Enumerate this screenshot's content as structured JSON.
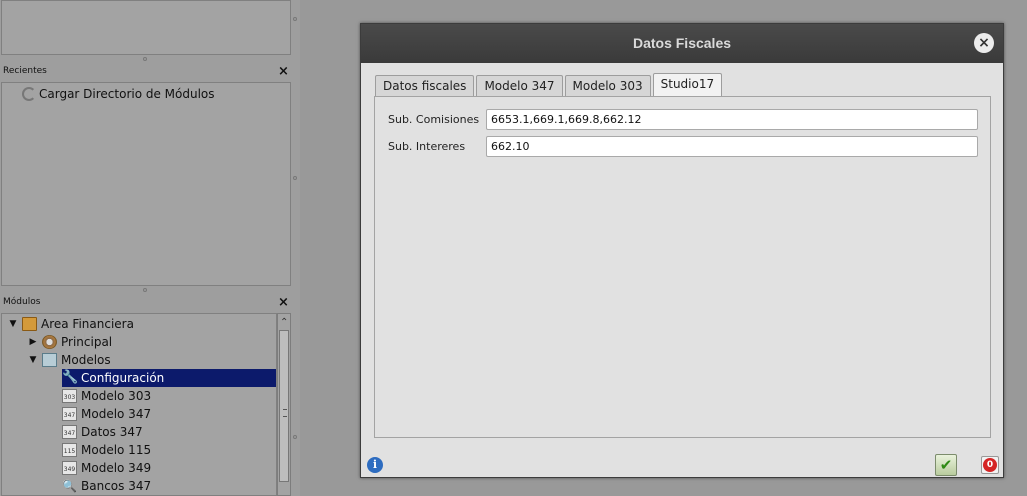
{
  "left_panel": {
    "recientes": {
      "title": "Recientes",
      "close_label": "×",
      "items": [
        {
          "label": "Cargar Directorio de Módulos"
        }
      ]
    },
    "modulos": {
      "title": "Módulos",
      "close_label": "×",
      "tree": [
        {
          "label": "Area Financiera",
          "arrow": "v",
          "icon": "folder-icon"
        },
        {
          "label": "Principal",
          "arrow": ">",
          "icon": "gear-icon"
        },
        {
          "label": "Modelos",
          "arrow": "v",
          "icon": "models-icon"
        },
        {
          "label": "Configuración",
          "icon": "wrench-icon",
          "selected": true
        },
        {
          "label": "Modelo 303",
          "icon": "document-icon",
          "icon_text": "303"
        },
        {
          "label": "Modelo 347",
          "icon": "document-icon",
          "icon_text": "347"
        },
        {
          "label": "Datos 347",
          "icon": "document-icon",
          "icon_text": "347"
        },
        {
          "label": "Modelo 115",
          "icon": "document-icon",
          "icon_text": "115"
        },
        {
          "label": "Modelo 349",
          "icon": "document-icon",
          "icon_text": "349"
        },
        {
          "label": "Bancos 347",
          "icon": "magnifier-icon"
        }
      ]
    }
  },
  "dialog": {
    "title": "Datos Fiscales",
    "close_label": "×",
    "tabs": [
      {
        "label": "Datos fiscales",
        "active": false
      },
      {
        "label": "Modelo 347",
        "active": false
      },
      {
        "label": "Modelo 303",
        "active": false
      },
      {
        "label": "Studio17",
        "active": true
      }
    ],
    "fields": [
      {
        "label": "Sub. Comisiones",
        "value": "6653.1,669.1,669.8,662.12"
      },
      {
        "label": "Sub. Intereres",
        "value": "662.10"
      }
    ],
    "info_label": "i",
    "ok_label": "✔",
    "cancel_label": "0"
  },
  "colors": {
    "selection": "#0c1a6b",
    "dialog_titlebar": "#3f3f3f",
    "ok_check": "#2f8a14",
    "cancel_red": "#d52424",
    "info_blue": "#2d6cc0"
  }
}
